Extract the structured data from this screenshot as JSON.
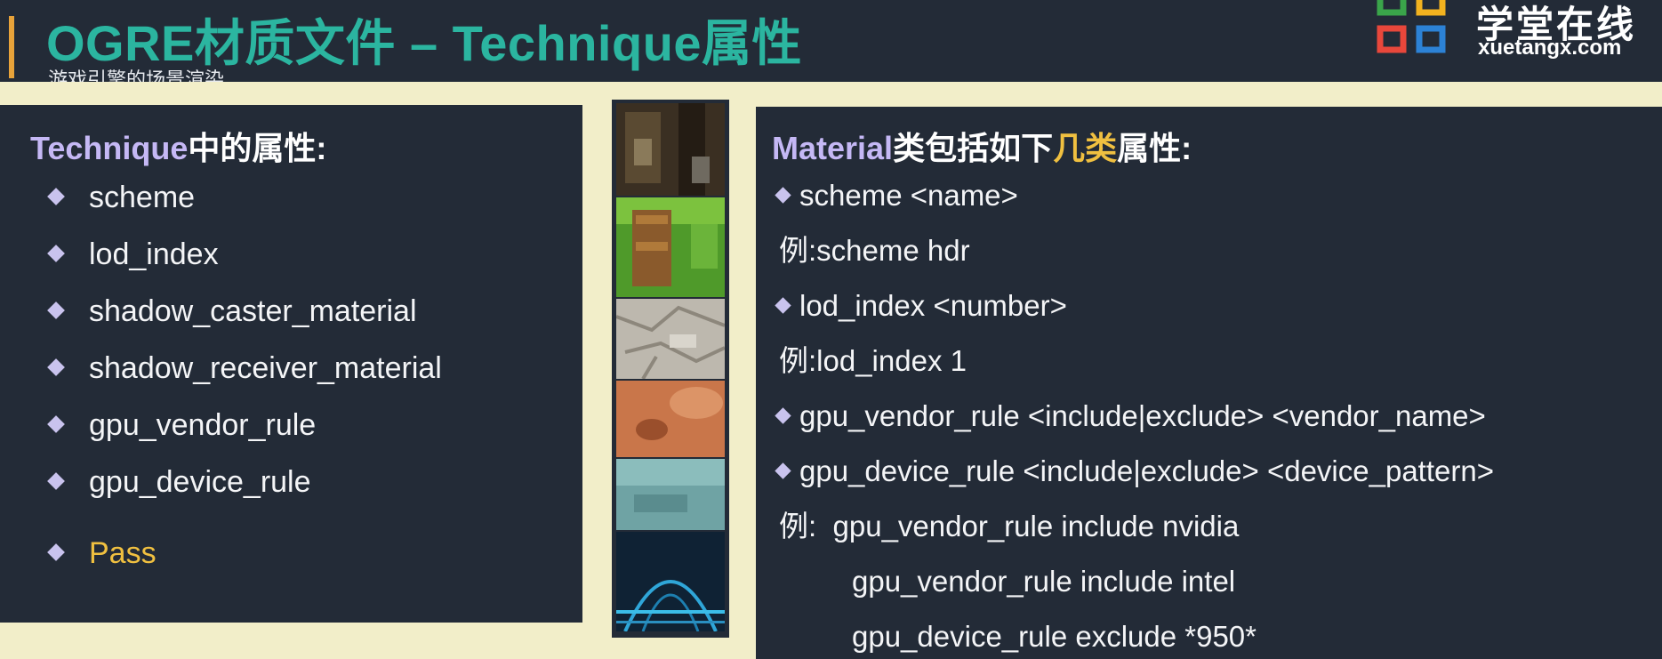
{
  "header": {
    "title": "OGRE材质文件 – Technique属性",
    "subtitle": "游戏引擎的场景渲染"
  },
  "logo": {
    "cn": "学堂在线",
    "en": "xuetangx.com"
  },
  "left": {
    "heading_highlight": "Technique",
    "heading_rest": "中的属性:",
    "items": [
      "scheme",
      "lod_index",
      "shadow_caster_material",
      "shadow_receiver_material",
      "gpu_vendor_rule",
      "gpu_device_rule"
    ],
    "pass_item": "Pass"
  },
  "right": {
    "heading_part1": "Material",
    "heading_part2": "类包括如下",
    "heading_part3": "几类",
    "heading_part4": "属性:",
    "lines": [
      "scheme <name>",
      "例:scheme hdr",
      "lod_index <number>",
      "例:lod_index 1",
      "gpu_vendor_rule <include|exclude> <vendor_name>",
      "gpu_device_rule <include|exclude> <device_pattern>",
      "例:  gpu_vendor_rule include nvidia",
      "gpu_vendor_rule include intel",
      "gpu_device_rule exclude *950*"
    ]
  },
  "colors": {
    "background": "#232b37",
    "title": "#2bb5a0",
    "accent": "#e8a33a",
    "highlight_purple": "#c5b8f5",
    "highlight_yellow": "#f0c040",
    "frame": "#f2eec9"
  },
  "thumbnails": [
    {
      "icon": "dungeon-texture"
    },
    {
      "icon": "grass-crate-texture"
    },
    {
      "icon": "stone-texture"
    },
    {
      "icon": "skin-texture"
    },
    {
      "icon": "ice-texture"
    },
    {
      "icon": "scifi-tunnel-texture"
    }
  ]
}
